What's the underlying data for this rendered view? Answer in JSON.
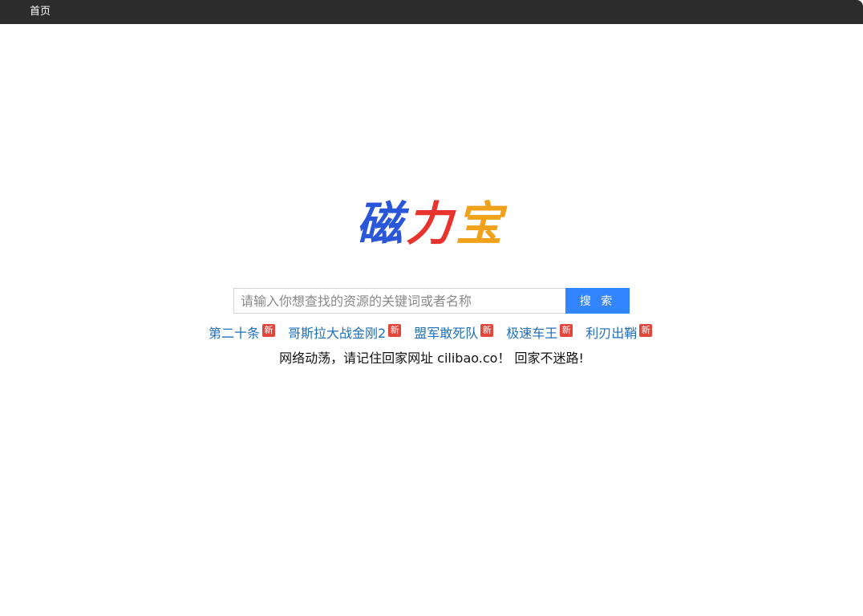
{
  "topbar": {
    "home_label": "首页"
  },
  "logo": {
    "chars": [
      "磁",
      "力",
      "宝"
    ],
    "colors": [
      "#2a56d9",
      "#e8332f",
      "#f0a21b"
    ]
  },
  "search": {
    "placeholder": "请输入你想查找的资源的关键词或者名称",
    "value": "",
    "button_label": "搜 索",
    "button_color": "#3385ff"
  },
  "hot": {
    "badge_label": "新",
    "items": [
      {
        "label": "第二十条"
      },
      {
        "label": "哥斯拉大战金刚2"
      },
      {
        "label": "盟军敢死队"
      },
      {
        "label": "极速车王"
      },
      {
        "label": "利刃出鞘"
      }
    ]
  },
  "notice": {
    "text": "网络动荡，请记住回家网址 cilibao.co！ 回家不迷路!"
  }
}
